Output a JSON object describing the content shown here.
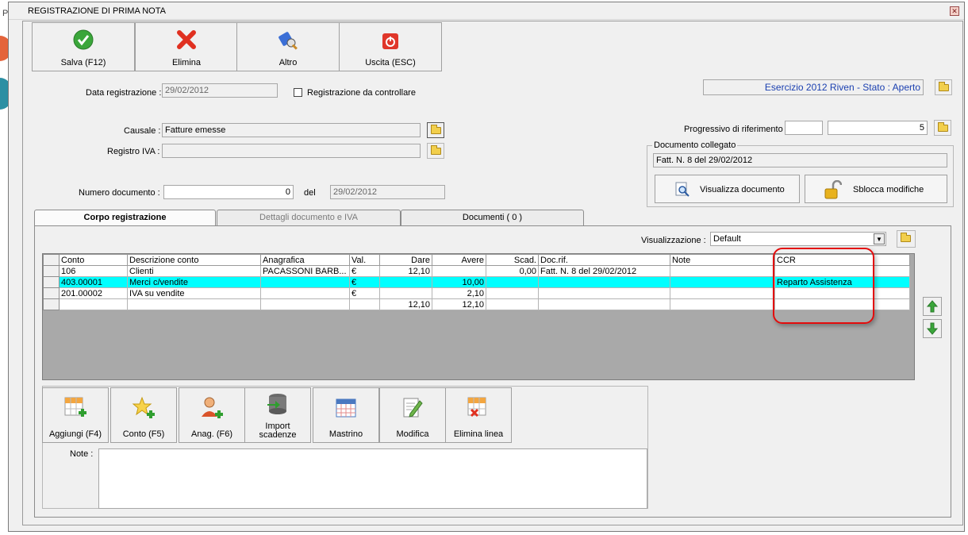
{
  "background_app": {
    "letter": "P"
  },
  "window": {
    "title": "REGISTRAZIONE DI PRIMA NOTA",
    "close_glyph": "✕"
  },
  "toolbar": [
    {
      "label": "Salva (F12)",
      "icon": "check-icon"
    },
    {
      "label": "Elimina",
      "icon": "delete-x-icon"
    },
    {
      "label": "Altro",
      "icon": "tools-icon"
    },
    {
      "label": "Uscita (ESC)",
      "icon": "power-icon"
    }
  ],
  "header": {
    "exercise_status": "Esercizio 2012 Riven - Stato : Aperto",
    "data_label": "Data registrazione :",
    "data_value": "29/02/2012",
    "check_label": "Registrazione da controllare",
    "causale_label": "Causale :",
    "causale_value": "Fatture emesse",
    "registro_label": "Registro IVA :",
    "registro_value": "",
    "progressivo_label": "Progressivo di riferimento :",
    "progressivo_a": "",
    "progressivo_b": "5",
    "numero_label": "Numero documento :",
    "numero_value": "0",
    "del_label": "del",
    "del_value": "29/02/2012"
  },
  "documento": {
    "group_label": "Documento collegato",
    "value": "Fatt. N. 8 del 29/02/2012",
    "view_button": "Visualizza documento",
    "unlock_button": "Sblocca modifiche"
  },
  "tabs": [
    {
      "label": "Corpo registrazione",
      "active": true
    },
    {
      "label": "Dettagli documento e IVA",
      "active": false
    },
    {
      "label": "Documenti ( 0 )",
      "active": false
    }
  ],
  "view": {
    "label": "Visualizzazione :",
    "value": "Default"
  },
  "grid": {
    "columns": [
      "Conto",
      "Descrizione conto",
      "Anagrafica",
      "Val.",
      "Dare",
      "Avere",
      "Scad.",
      "Doc.rif.",
      "Note",
      "CCR"
    ],
    "rows": [
      [
        "106",
        "Clienti",
        "PACASSONI BARB...",
        "€",
        "12,10",
        "",
        "0,00",
        "Fatt. N. 8 del 29/02/2012",
        "",
        ""
      ],
      [
        "403.00001",
        "Merci c/vendite",
        "",
        "€",
        "",
        "10,00",
        "",
        "",
        "",
        "Reparto Assistenza"
      ],
      [
        "201.00002",
        "IVA su vendite",
        "",
        "€",
        "",
        "2,10",
        "",
        "",
        "",
        ""
      ],
      [
        "",
        "",
        "",
        "",
        "12,10",
        "12,10",
        "",
        "",
        "",
        ""
      ]
    ],
    "selected_row": 1
  },
  "bottom_buttons": [
    {
      "label": "Aggiungi (F4)",
      "icon": "grid-add-icon"
    },
    {
      "label": "Conto (F5)",
      "icon": "star-add-icon"
    },
    {
      "label": "Anag. (F6)",
      "icon": "person-add-icon"
    },
    {
      "label": "Import\nscadenze",
      "icon": "database-import-icon"
    },
    {
      "label": "Mastrino",
      "icon": "calendar-icon"
    },
    {
      "label": "Modifica",
      "icon": "edit-document-icon"
    },
    {
      "label": "Elimina linea",
      "icon": "grid-delete-icon"
    }
  ],
  "note": {
    "label": "Note :",
    "value": ""
  },
  "colors": {
    "selected_row": "#00ffff",
    "highlight": "#e30b0b",
    "status_text": "#1a3fb0"
  }
}
